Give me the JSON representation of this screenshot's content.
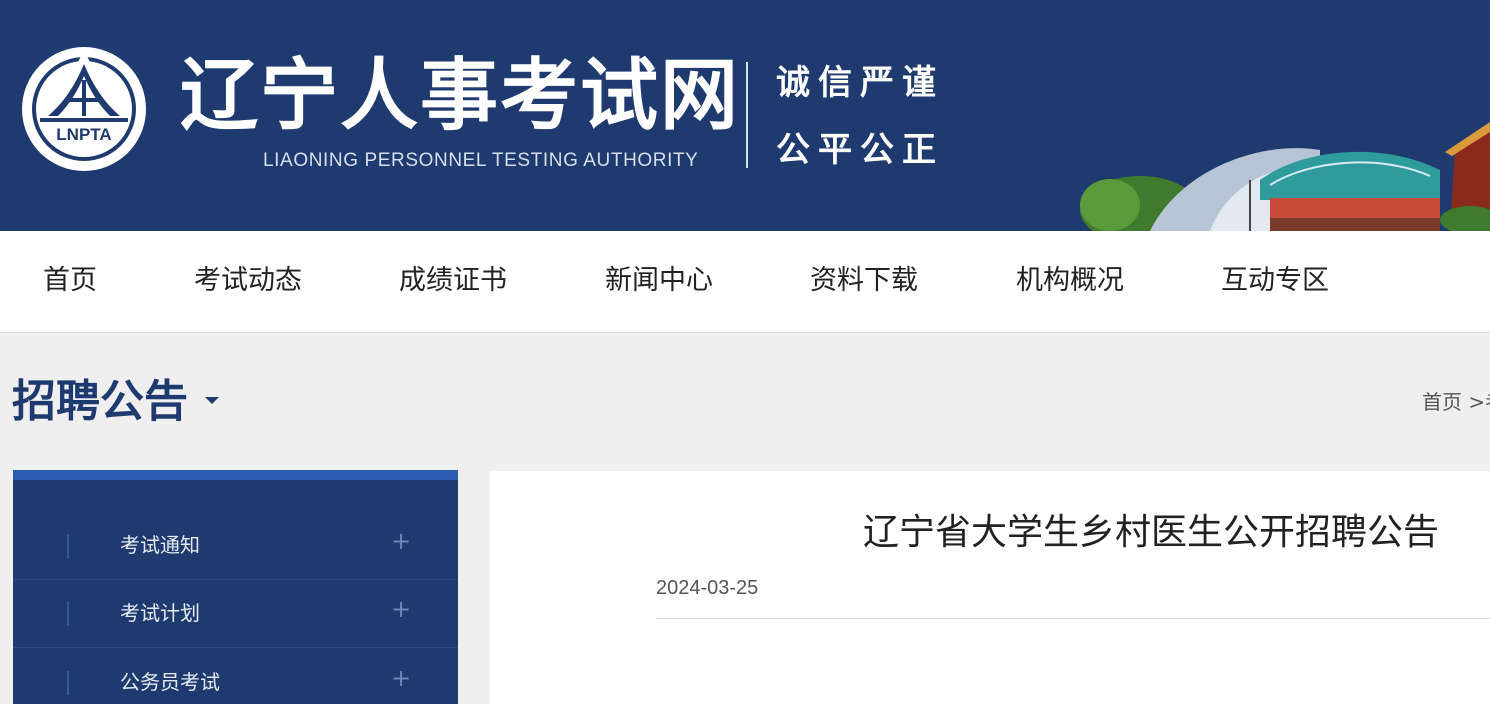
{
  "header": {
    "logo_text": "LNPTA",
    "title": "辽宁人事考试网",
    "subtitle": "LIAONING PERSONNEL TESTING AUTHORITY",
    "motto_line1": "诚信严谨",
    "motto_line2": "公平公正",
    "background_color": "#1f3a6e"
  },
  "nav": {
    "items": [
      "首页",
      "考试动态",
      "成绩证书",
      "新闻中心",
      "资料下载",
      "机构概况",
      "互动专区"
    ]
  },
  "section": {
    "title": "招聘公告",
    "breadcrumb": "首页 >考"
  },
  "sidebar": {
    "items": [
      {
        "label": "考试通知",
        "expand_icon": "plus-icon"
      },
      {
        "label": "考试计划",
        "expand_icon": "plus-icon"
      },
      {
        "label": "公务员考试",
        "expand_icon": "plus-icon"
      }
    ],
    "accent_color": "#2a5db0"
  },
  "article": {
    "title": "辽宁省大学生乡村医生公开招聘公告",
    "date": "2024-03-25"
  }
}
